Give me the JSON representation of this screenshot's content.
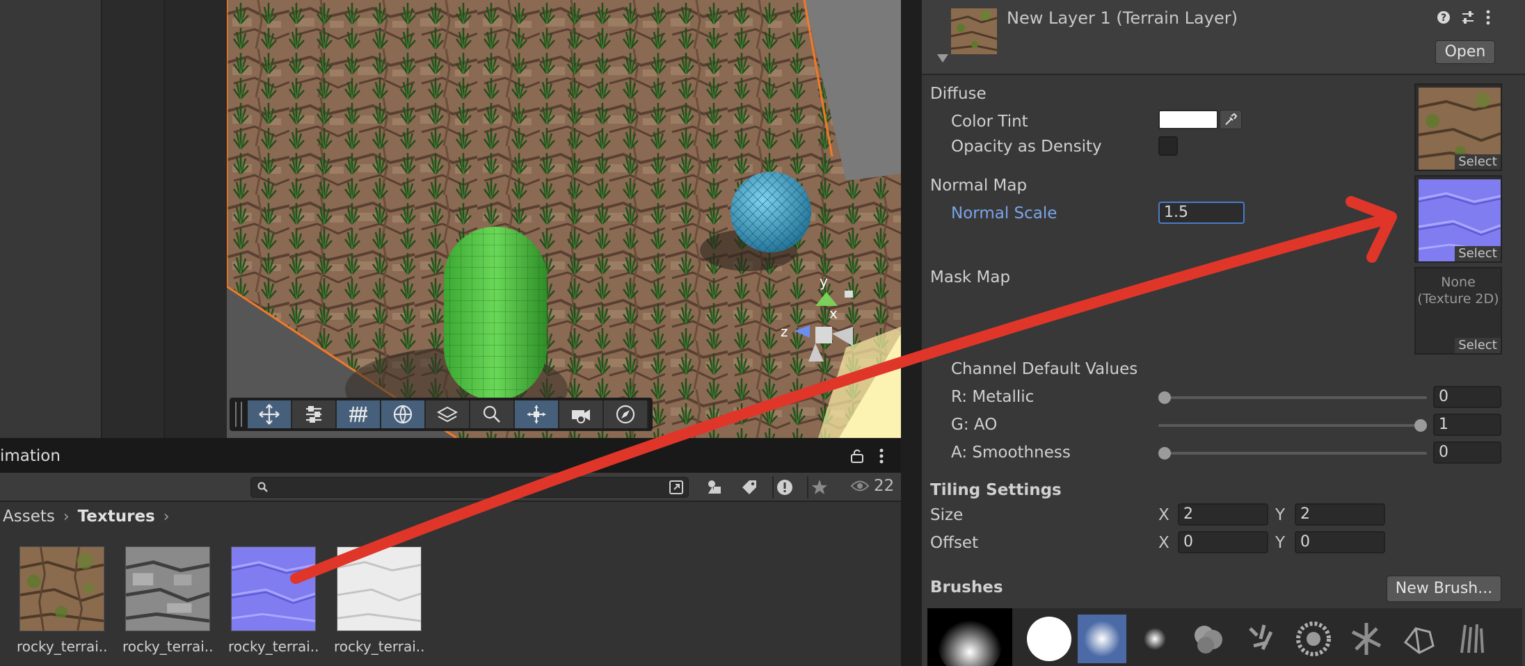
{
  "project": {
    "tab_label": "imation",
    "search_placeholder": "",
    "visible_count": "22",
    "breadcrumb": [
      "Assets",
      "Textures"
    ],
    "assets": [
      {
        "label": "rocky_terrai...",
        "thumb": "diffuse"
      },
      {
        "label": "rocky_terrai...",
        "thumb": "height"
      },
      {
        "label": "rocky_terrai...",
        "thumb": "normal"
      },
      {
        "label": "rocky_terrai...",
        "thumb": "ao"
      }
    ]
  },
  "scene": {
    "gizmo_labels": {
      "y": "y",
      "x": "x",
      "z": "z"
    }
  },
  "inspector": {
    "title": "New Layer 1 (Terrain Layer)",
    "open_label": "Open",
    "diffuse": {
      "section": "Diffuse",
      "color_tint_label": "Color Tint",
      "color_tint_value": "#ffffff",
      "opacity_label": "Opacity as Density",
      "select_label": "Select"
    },
    "normal": {
      "section": "Normal Map",
      "scale_label": "Normal Scale",
      "scale_value": "1.5",
      "select_label": "Select"
    },
    "mask": {
      "section": "Mask Map",
      "none_label": "None",
      "none_type": "(Texture 2D)",
      "select_label": "Select",
      "channel_defaults_label": "Channel Default Values",
      "channels": [
        {
          "label": "R: Metallic",
          "value": "0",
          "fraction": 0
        },
        {
          "label": "G: AO",
          "value": "1",
          "fraction": 1
        },
        {
          "label": "A: Smoothness",
          "value": "0",
          "fraction": 0
        }
      ]
    },
    "tiling": {
      "section": "Tiling Settings",
      "size_label": "Size",
      "size_x": "2",
      "size_y": "2",
      "offset_label": "Offset",
      "offset_x": "0",
      "offset_y": "0",
      "x_label": "X",
      "y_label": "Y"
    },
    "brushes": {
      "section": "Brushes",
      "new_brush_label": "New Brush..."
    }
  },
  "colors": {
    "accent_blue": "#7ba4e8",
    "annotation_red": "#e0362a",
    "selection_orange": "#f07a2a"
  }
}
